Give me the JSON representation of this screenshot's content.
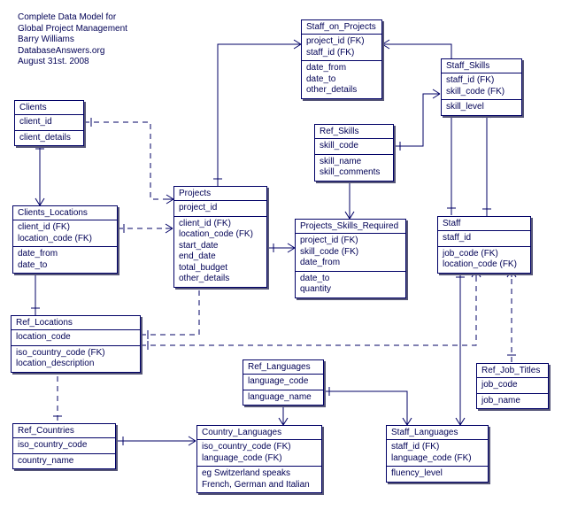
{
  "title": {
    "line1": "Complete Data Model for",
    "line2": "Global Project Management",
    "line3": "Barry Williams",
    "line4": "DatabaseAnswers.org",
    "line5": "August 31st. 2008"
  },
  "entities": {
    "clients": {
      "name": "Clients",
      "pk": [
        "client_id"
      ],
      "attrs": [
        "client_details"
      ]
    },
    "clients_locations": {
      "name": "Clients_Locations",
      "pk": [
        "client_id (FK)",
        "location_code (FK)"
      ],
      "attrs": [
        "date_from",
        "date_to"
      ]
    },
    "projects": {
      "name": "Projects",
      "pk": [
        "project_id"
      ],
      "attrs": [
        "client_id (FK)",
        "location_code (FK)",
        "start_date",
        "end_date",
        "total_budget",
        "other_details"
      ]
    },
    "staff_on_projects": {
      "name": "Staff_on_Projects",
      "pk": [
        "project_id (FK)",
        "staff_id (FK)"
      ],
      "attrs": [
        "date_from",
        "date_to",
        "other_details"
      ]
    },
    "staff_skills": {
      "name": "Staff_Skills",
      "pk": [
        "staff_id (FK)",
        "skill_code (FK)"
      ],
      "attrs": [
        "skill_level"
      ]
    },
    "ref_skills": {
      "name": "Ref_Skills",
      "pk": [
        "skill_code"
      ],
      "attrs": [
        "skill_name",
        "skill_comments"
      ]
    },
    "staff": {
      "name": "Staff",
      "pk": [
        "staff_id"
      ],
      "attrs": [
        "job_code (FK)",
        "location_code (FK)"
      ]
    },
    "projects_skills_required": {
      "name": "Projects_Skills_Required",
      "pk": [
        "project_id (FK)",
        "skill_code (FK)",
        "date_from"
      ],
      "attrs": [
        "date_to",
        "quantity"
      ]
    },
    "ref_locations": {
      "name": "Ref_Locations",
      "pk": [
        "location_code"
      ],
      "attrs": [
        "iso_country_code (FK)",
        "location_description"
      ]
    },
    "ref_languages": {
      "name": "Ref_Languages",
      "pk": [
        "language_code"
      ],
      "attrs": [
        "language_name"
      ]
    },
    "ref_job_titles": {
      "name": "Ref_Job_Titles",
      "pk": [
        "job_code"
      ],
      "attrs": [
        "job_name"
      ]
    },
    "ref_countries": {
      "name": "Ref_Countries",
      "pk": [
        "iso_country_code"
      ],
      "attrs": [
        "country_name"
      ]
    },
    "country_languages": {
      "name": "Country_Languages",
      "pk": [
        "iso_country_code (FK)",
        "language_code (FK)"
      ],
      "attrs": [
        "eg Switzerland speaks",
        "French, German and Italian"
      ]
    },
    "staff_languages": {
      "name": "Staff_Languages",
      "pk": [
        "staff_id (FK)",
        "language_code (FK)"
      ],
      "attrs": [
        "fluency_level"
      ]
    }
  }
}
